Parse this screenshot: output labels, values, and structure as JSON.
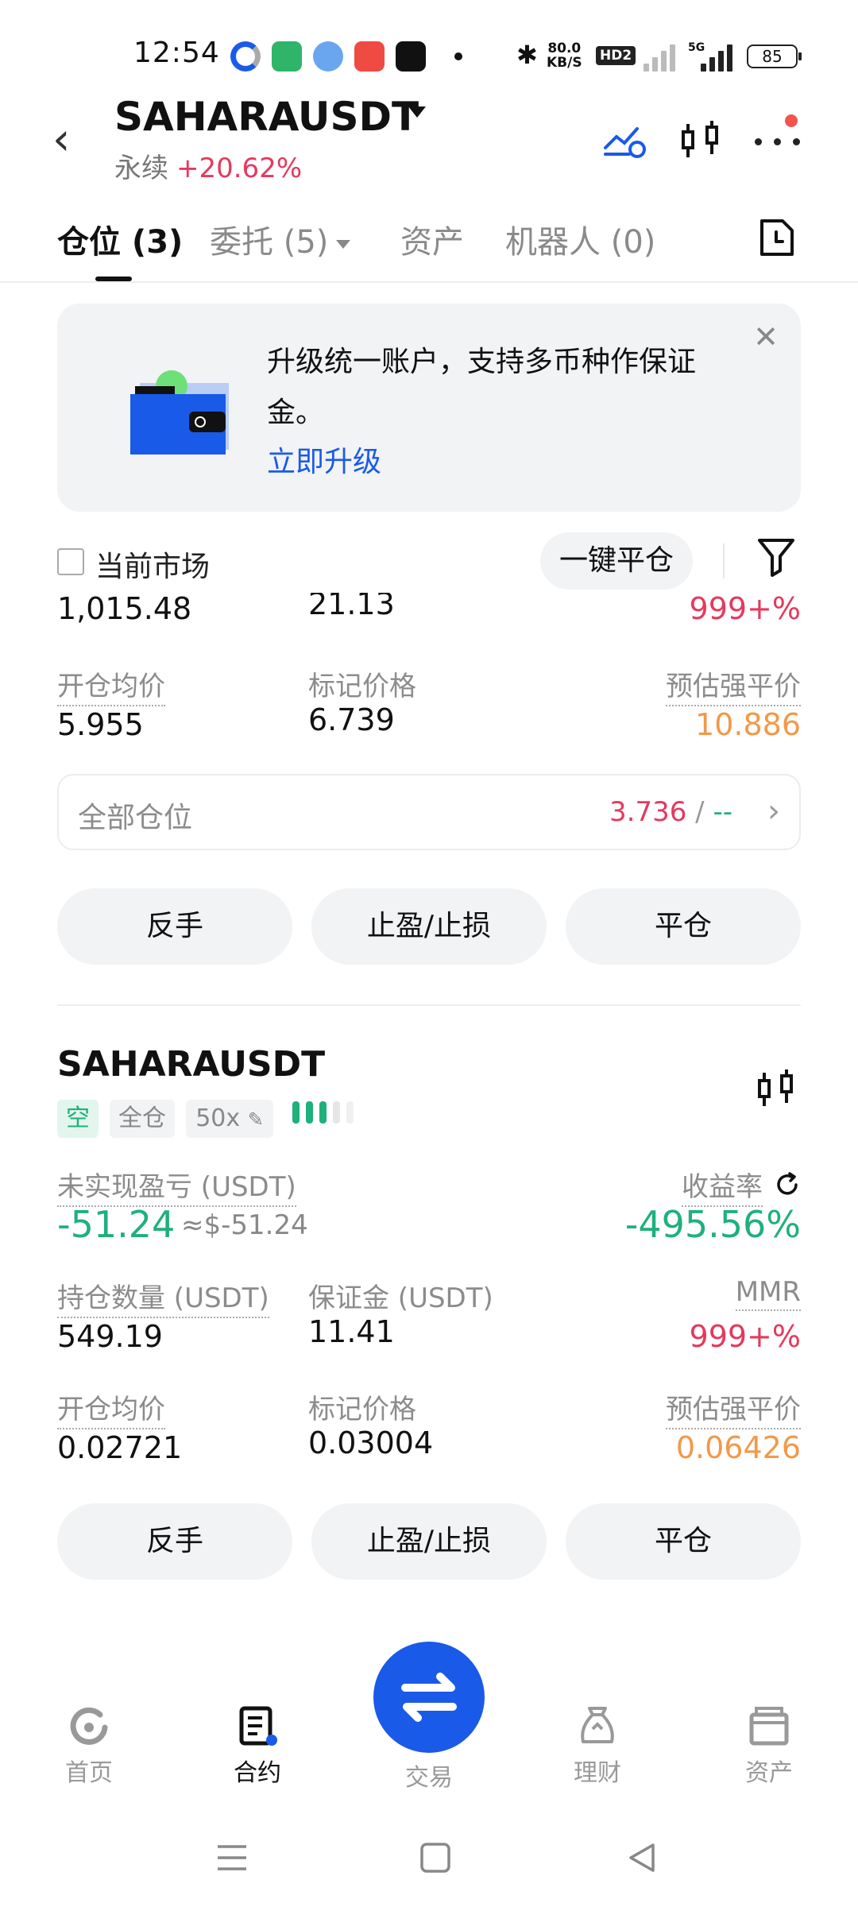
{
  "status_bar": {
    "time": "12:54",
    "net_speed": "80.0",
    "net_speed_unit": "KB/S",
    "hd_badge": "HD2",
    "net_type": "5G",
    "battery": "85"
  },
  "header": {
    "symbol": "SAHARAUSDT",
    "contract_type": "永续",
    "change": "+20.62%"
  },
  "tabs": {
    "positions": "仓位 (3)",
    "orders": "委托 (5)",
    "assets": "资产",
    "bots": "机器人 (0)"
  },
  "banner": {
    "text": "升级统一账户，支持多币种作保证金。",
    "link": "立即升级"
  },
  "filter": {
    "current_market": "当前市场",
    "close_all": "一键平仓"
  },
  "position1": {
    "partial_qty": "1,015.48",
    "partial_margin": "21.13",
    "partial_mmr": "999+%",
    "open_price_label": "开仓均价",
    "open_price": "5.955",
    "mark_price_label": "标记价格",
    "mark_price": "6.739",
    "liq_price_label": "预估强平价",
    "liq_price": "10.886",
    "all_positions_label": "全部仓位",
    "all_positions_value": "3.736",
    "all_positions_sep": " / ",
    "all_positions_value2": "--"
  },
  "buttons": {
    "reverse": "反手",
    "tpsl": "止盈/止损",
    "close": "平仓"
  },
  "position2": {
    "symbol": "SAHARAUSDT",
    "side": "空",
    "margin_mode": "全仓",
    "leverage": "50x",
    "pnl_label": "未实现盈亏 (USDT)",
    "pnl": "-51.24",
    "pnl_usd": "≈$-51.24",
    "roe_label": "收益率",
    "roe": "-495.56%",
    "qty_label": "持仓数量 (USDT)",
    "qty": "549.19",
    "margin_label": "保证金 (USDT)",
    "margin": "11.41",
    "mmr_label": "MMR",
    "mmr": "999+%",
    "open_price_label": "开仓均价",
    "open_price": "0.02721",
    "mark_price_label": "标记价格",
    "mark_price": "0.03004",
    "liq_price_label": "预估强平价",
    "liq_price": "0.06426",
    "risk_bars_filled": 3,
    "risk_bars_total": 5
  },
  "bottom_nav": {
    "home": "首页",
    "futures": "合约",
    "trade": "交易",
    "earn": "理财",
    "assets": "资产"
  },
  "colors": {
    "accent": "#1a5ae8",
    "up_red": "#e5395e",
    "down_green": "#1fb07c",
    "liq_orange": "#f2994a"
  }
}
